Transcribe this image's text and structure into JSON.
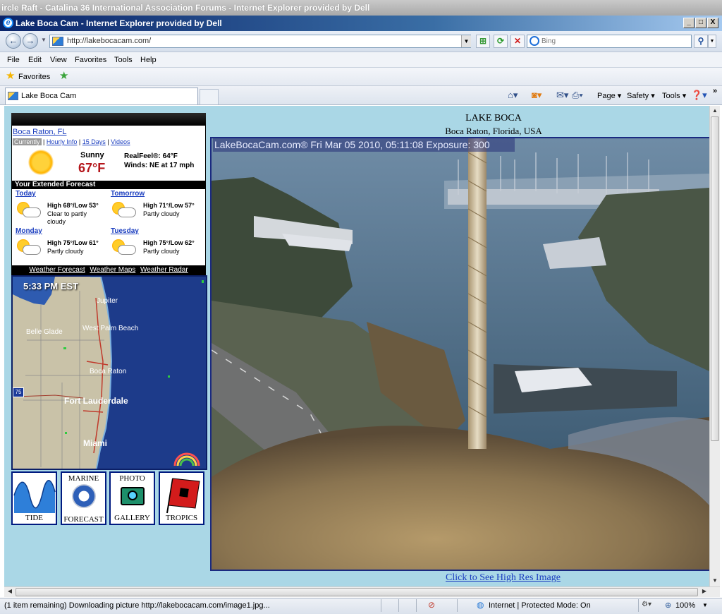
{
  "background_window": {
    "title": "ircle Raft - Catalina 36 International Association Forums - Internet Explorer provided by Dell"
  },
  "window": {
    "title": "Lake Boca Cam - Internet Explorer provided by Dell",
    "minimize": "_",
    "maximize": "□",
    "close": "X"
  },
  "address_bar": {
    "url": "http://lakebocacam.com/"
  },
  "search": {
    "provider": "Bing",
    "placeholder": "Bing"
  },
  "menu": [
    "File",
    "Edit",
    "View",
    "Favorites",
    "Tools",
    "Help"
  ],
  "favorites_bar": {
    "label": "Favorites"
  },
  "tab": {
    "label": "Lake Boca Cam"
  },
  "command_bar": {
    "page": "Page ▾",
    "safety": "Safety ▾",
    "tools": "Tools ▾",
    "chevron": "»"
  },
  "weather": {
    "city": "Boca Raton, FL",
    "tabs": {
      "current": "Currently",
      "hourly": "Hourly Info",
      "days": "15 Days",
      "videos": "Videos"
    },
    "current": {
      "condition": "Sunny",
      "temp": "67°F",
      "realfeel": "RealFeel®: 64°F",
      "wind": "Winds: NE at 17 mph"
    },
    "extended_title": "Your Extended Forecast",
    "forecast": [
      {
        "day": "Today",
        "hilo": "High 68°/Low 53°",
        "cond": "Clear to partly cloudy"
      },
      {
        "day": "Tomorrow",
        "hilo": "High 71°/Low 57°",
        "cond": "Partly cloudy"
      },
      {
        "day": "Monday",
        "hilo": "High 75°/Low 61°",
        "cond": "Partly cloudy"
      },
      {
        "day": "Tuesday",
        "hilo": "High 75°/Low 62°",
        "cond": "Partly cloudy"
      }
    ],
    "footer_links": [
      "Weather Forecast",
      "Weather Maps",
      "Weather Radar"
    ]
  },
  "map": {
    "time": "5:33 PM EST",
    "labels": {
      "jupiter": "Jupiter",
      "wpb": "West Palm Beach",
      "belle": "Belle Glade",
      "boca": "Boca Raton",
      "ftl": "Fort Lauderdale",
      "miami": "Miami",
      "interstate": "75"
    }
  },
  "buttons": [
    {
      "label": "TIDE"
    },
    {
      "top": "MARINE",
      "label": "FORECAST"
    },
    {
      "top": "PHOTO",
      "label": "GALLERY"
    },
    {
      "label": "TROPICS"
    }
  ],
  "cam": {
    "title": "LAKE BOCA",
    "subtitle": "Boca Raton, Florida, USA",
    "overlay": "LakeBocaCam.com® Fri Mar 05 2010, 05:11:08 Exposure: 300",
    "link": "Click to See High Res Image"
  },
  "status": {
    "text": "(1 item remaining) Downloading picture http://lakebocacam.com/image1.jpg...",
    "zone": "Internet | Protected Mode: On",
    "zoom": "100%"
  }
}
